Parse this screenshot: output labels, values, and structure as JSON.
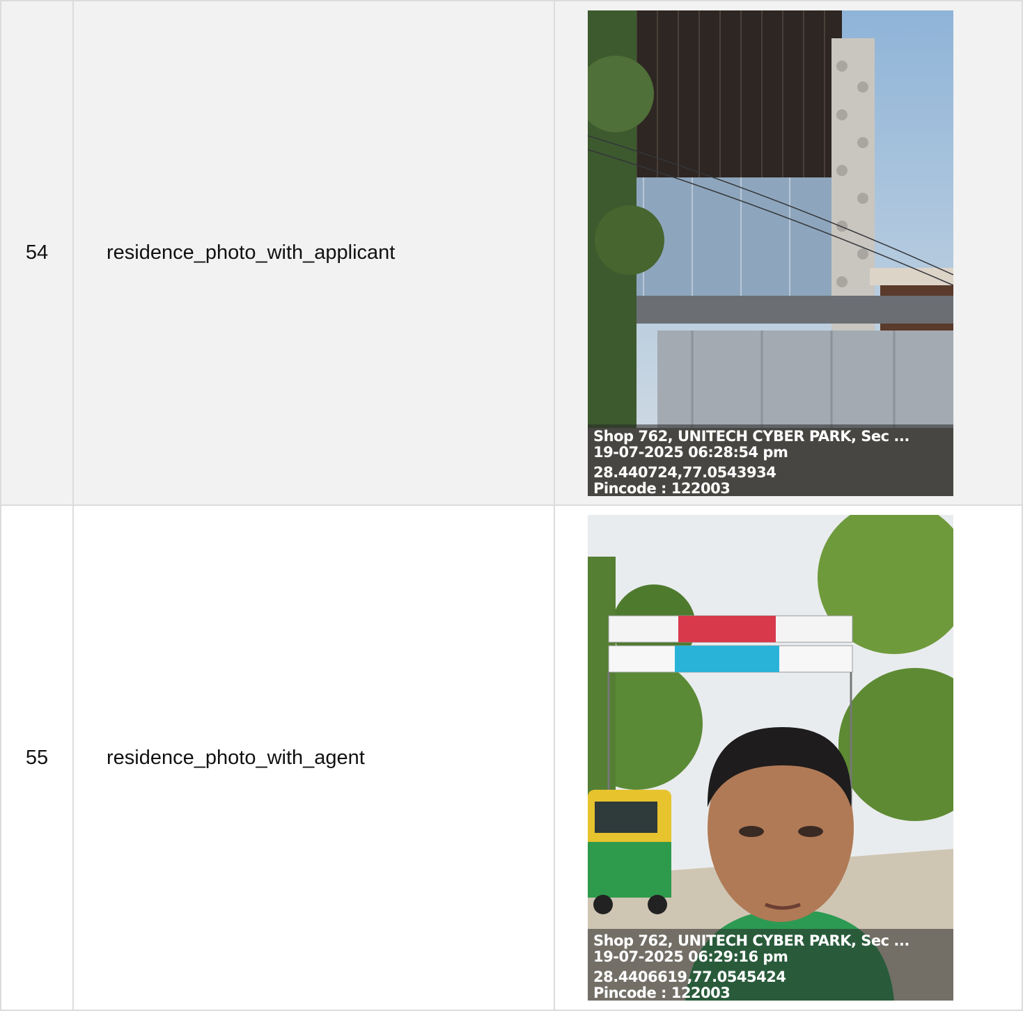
{
  "rows": [
    {
      "number": "54",
      "label": "residence_photo_with_applicant",
      "photo": {
        "subject": "building-facade",
        "stamp": {
          "address": "Shop 762, UNITECH CYBER PARK, Sec ...",
          "datetime": "19-07-2025 06:28:54 pm",
          "coordinates": "28.440724,77.0543934",
          "pincode": "Pincode : 122003"
        }
      }
    },
    {
      "number": "55",
      "label": "residence_photo_with_agent",
      "photo": {
        "subject": "agent-selfie-street",
        "stamp": {
          "address": "Shop 762, UNITECH CYBER PARK, Sec ...",
          "datetime": "19-07-2025 06:29:16 pm",
          "coordinates": "28.4406619,77.0545424",
          "pincode": "Pincode : 122003"
        }
      }
    }
  ],
  "colors": {
    "row_shaded": "#f2f2f2",
    "row_plain": "#ffffff",
    "border": "#dcdcdc"
  }
}
